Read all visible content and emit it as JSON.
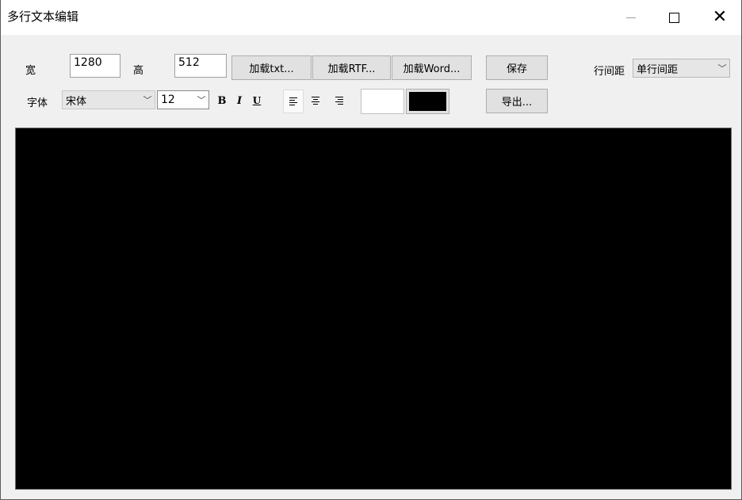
{
  "window": {
    "title": "多行文本编辑"
  },
  "size": {
    "width_label": "宽",
    "width_value": "1280",
    "height_label": "高",
    "height_value": "512"
  },
  "toolbar": {
    "load_txt": "加载txt...",
    "load_rtf": "加载RTF...",
    "load_word": "加载Word...",
    "save": "保存",
    "export": "导出...",
    "line_spacing_label": "行间距",
    "line_spacing_value": "单行间距"
  },
  "font": {
    "label": "字体",
    "family": "宋体",
    "size": "12",
    "bold": "B",
    "italic": "I",
    "underline": "U"
  },
  "icons": {
    "minimize": "minimize-icon",
    "maximize": "maximize-icon",
    "close": "close-icon",
    "align_left": "align-left-icon",
    "align_center": "align-center-icon",
    "align_right": "align-right-icon",
    "dropdown": "chevron-down-icon"
  },
  "colors": {
    "background_swatch": "#ffffff",
    "text_swatch": "#000000",
    "canvas": "#000000"
  }
}
